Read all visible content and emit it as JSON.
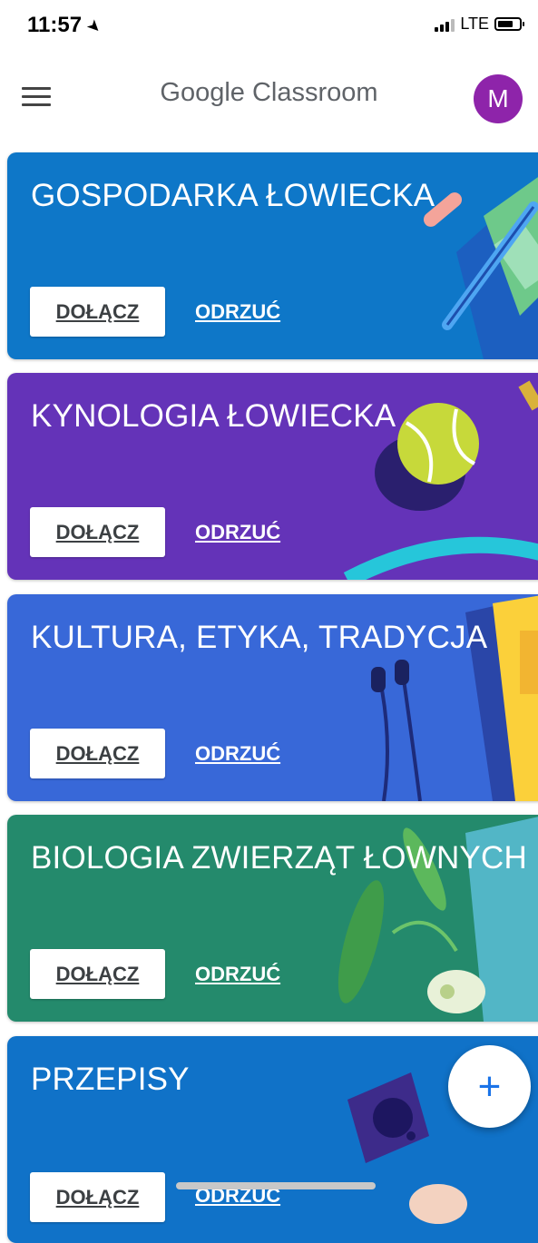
{
  "status_bar": {
    "time": "11:57",
    "network": "LTE"
  },
  "app_bar": {
    "title": "Google Classroom",
    "avatar_initial": "M"
  },
  "colors": {
    "card1": "#0e77c8",
    "card2": "#6433b8",
    "card3": "#3868d8",
    "card4": "#248a6c",
    "card5": "#1072c8",
    "avatar": "#8e24aa",
    "fab_plus": "#1a73e8"
  },
  "classes": [
    {
      "title": "GOSPODARKA ŁOWIECKA",
      "join_label": "DOŁĄCZ",
      "reject_label": "ODRZUĆ"
    },
    {
      "title": "KYNOLOGIA ŁOWIECKA",
      "join_label": "DOŁĄCZ",
      "reject_label": "ODRZUĆ"
    },
    {
      "title": "KULTURA, ETYKA, TRADYCJA",
      "join_label": "DOŁĄCZ",
      "reject_label": "ODRZUĆ"
    },
    {
      "title": "BIOLOGIA ZWIERZĄT ŁOWNYCH",
      "join_label": "DOŁĄCZ",
      "reject_label": "ODRZUĆ"
    },
    {
      "title": "PRZEPISY",
      "join_label": "DOŁĄCZ",
      "reject_label": "ODRZUĆ"
    }
  ],
  "fab": {
    "icon": "plus-icon",
    "label": "+"
  }
}
